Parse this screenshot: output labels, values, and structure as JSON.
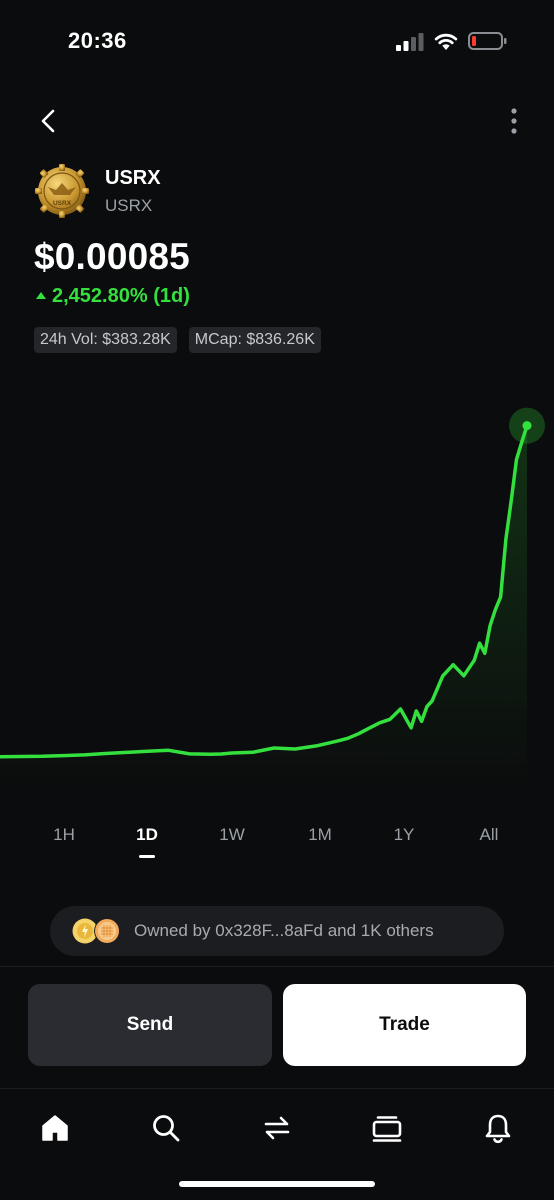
{
  "status_bar": {
    "time": "20:36"
  },
  "token": {
    "name": "USRX",
    "symbol": "USRX",
    "logo_text": "USRX",
    "price": "$0.00085",
    "change": "2,452.80% (1d)",
    "change_color": "#34e03e"
  },
  "stats": {
    "volume": "24h Vol: $383.28K",
    "mcap": "MCap: $836.26K"
  },
  "chart_data": {
    "type": "line",
    "series_color": "#34e03e",
    "grid": false,
    "x": [
      0,
      4,
      8,
      12,
      16,
      20,
      24,
      28,
      32,
      36,
      40,
      42,
      44,
      48,
      52,
      56,
      60,
      64,
      66,
      68,
      70,
      72,
      74,
      76,
      78,
      79,
      80,
      81,
      82,
      84,
      86,
      88,
      90,
      91,
      92,
      93,
      94,
      95,
      96,
      97,
      98,
      99,
      100
    ],
    "values": [
      4,
      4.1,
      4.3,
      4.8,
      5.3,
      6.4,
      7.2,
      8.1,
      8.8,
      6.1,
      5.8,
      6,
      6.8,
      7.3,
      10.5,
      9.8,
      12.1,
      15.7,
      17.8,
      21.2,
      25.3,
      29.4,
      32.1,
      39.8,
      25.7,
      38.4,
      30.6,
      41.6,
      45.9,
      64.6,
      73.1,
      64.8,
      76.5,
      89.3,
      81.7,
      102.4,
      114.6,
      123.9,
      167.6,
      196.3,
      227.3,
      240.2,
      252.8
    ],
    "ylim": [
      0,
      260
    ],
    "ranges": [
      "1H",
      "1D",
      "1W",
      "1M",
      "1Y",
      "All"
    ],
    "selected_range": "1D"
  },
  "owners": {
    "text": "Owned by 0x328F...8aFd and 1K others"
  },
  "actions": {
    "send": "Send",
    "trade": "Trade"
  },
  "tabbar": {
    "items": [
      {
        "icon": "home-icon"
      },
      {
        "icon": "search-icon"
      },
      {
        "icon": "swap-icon"
      },
      {
        "icon": "activity-icon"
      },
      {
        "icon": "bell-icon"
      }
    ]
  }
}
